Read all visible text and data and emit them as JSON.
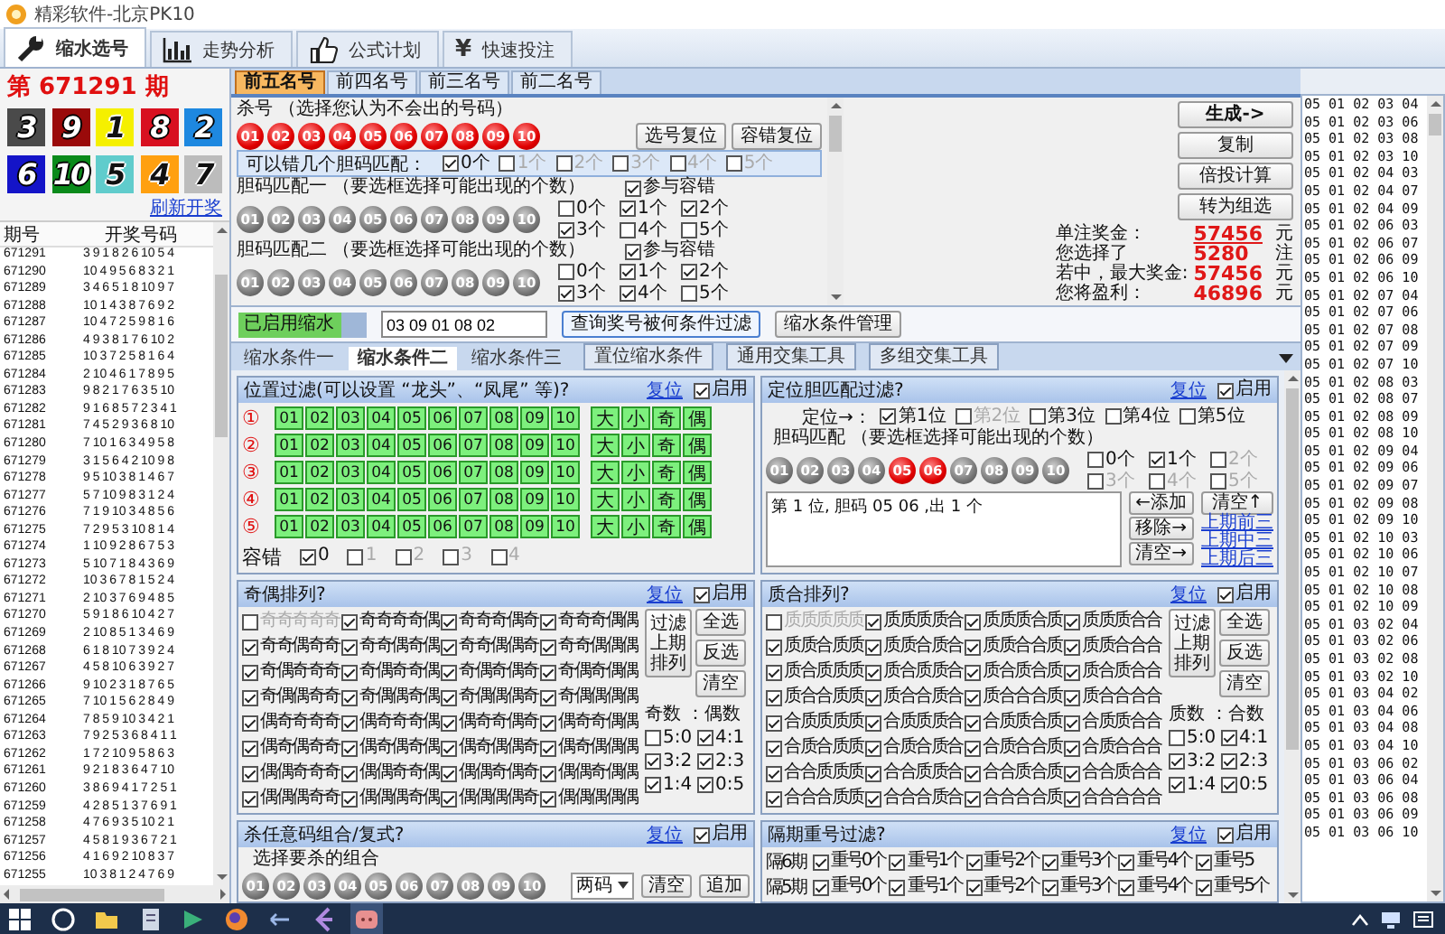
{
  "window": {
    "title": "精彩软件-北京PK10"
  },
  "main_tabs": [
    {
      "label": "缩水选号",
      "selected": true
    },
    {
      "label": "走势分析",
      "selected": false
    },
    {
      "label": "公式计划",
      "selected": false
    },
    {
      "label": "快速投注",
      "selected": false,
      "symbol": "¥"
    }
  ],
  "draw": {
    "title": "第 671291 期",
    "numbers": [
      {
        "label": "3",
        "color": "#4a4a4a"
      },
      {
        "label": "9",
        "color": "#9a0a0a"
      },
      {
        "label": "1",
        "color": "#f5f000"
      },
      {
        "label": "8",
        "color": "#d81020"
      },
      {
        "label": "2",
        "color": "#1e88e0"
      },
      {
        "label": "6",
        "color": "#1414c8"
      },
      {
        "label": "10",
        "color": "#0a8a1a"
      },
      {
        "label": "5",
        "color": "#60cccc"
      },
      {
        "label": "4",
        "color": "#ffa010"
      },
      {
        "label": "7",
        "color": "#bcbcbc"
      }
    ],
    "link": "刷新开奖"
  },
  "history": {
    "columns": [
      "期号",
      "开奖号码"
    ],
    "rows": [
      [
        "671291",
        "3 9 1 8 2 6 10 5 4"
      ],
      [
        "671290",
        "10 4 9 5 6 8 3 2 1"
      ],
      [
        "671289",
        "3 4 6 5 1 8 10 9 7"
      ],
      [
        "671288",
        "10 1 4 3 8 7 6 9 2"
      ],
      [
        "671287",
        "10 4 7 2 5 9 8 1 6"
      ],
      [
        "671286",
        "4 9 3 8 1 7 6 10 2"
      ],
      [
        "671285",
        "10 3 7 2 5 8 1 6 4"
      ],
      [
        "671284",
        "2 10 4 6 1 7 8 9 5"
      ],
      [
        "671283",
        "9 8 2 1 7 6 3 5 10"
      ],
      [
        "671282",
        "9 1 6 8 5 7 2 3 4 1"
      ],
      [
        "671281",
        "7 4 5 2 9 3 6 8 10"
      ],
      [
        "671280",
        "7 10 1 6 3 4 9 5 8"
      ],
      [
        "671279",
        "3 1 5 6 4 2 10 9 8"
      ],
      [
        "671278",
        "9 5 10 3 8 1 4 6 7"
      ],
      [
        "671277",
        "5 7 10 9 8 3 1 2 4"
      ],
      [
        "671276",
        "7 1 9 10 3 4 8 5 6"
      ],
      [
        "671275",
        "7 2 9 5 3 10 8 1 4"
      ],
      [
        "671274",
        "1 10 9 2 8 6 7 5 3"
      ],
      [
        "671273",
        "5 10 7 1 8 4 3 6 9"
      ],
      [
        "671272",
        "10 3 6 7 8 1 5 2 4"
      ],
      [
        "671271",
        "2 10 3 7 6 9 4 8 5"
      ],
      [
        "671270",
        "5 9 1 8 6 10 4 2 7"
      ],
      [
        "671269",
        "2 10 8 5 1 3 4 6 9"
      ],
      [
        "671268",
        "6 1 8 10 7 3 9 2 4"
      ],
      [
        "671267",
        "4 5 8 10 6 3 9 2 7"
      ],
      [
        "671266",
        "9 10 2 3 1 8 7 6 5"
      ],
      [
        "671265",
        "7 10 1 5 6 2 8 4 9"
      ],
      [
        "671264",
        "7 8 5 9 10 3 4 2 1"
      ],
      [
        "671263",
        "7 9 2 5 3 6 8 4 1 1"
      ],
      [
        "671262",
        "1 7 2 10 9 5 8 6 3"
      ],
      [
        "671261",
        "9 2 1 8 3 6 4 7 10"
      ],
      [
        "671260",
        "3 8 6 9 4 1 7 2 5 1"
      ],
      [
        "671259",
        "4 2 8 5 1 3 7 6 9 1"
      ],
      [
        "671258",
        "4 7 6 9 3 5 10 2 1"
      ],
      [
        "671257",
        "4 5 8 1 9 3 6 7 2 1"
      ],
      [
        "671256",
        "4 1 6 9 2 10 8 3 7"
      ],
      [
        "671255",
        "10 3 8 1 2 4 7 6 9"
      ]
    ]
  },
  "sub_tabs": [
    {
      "label": "前五名号",
      "selected": true
    },
    {
      "label": "前四名号",
      "selected": false
    },
    {
      "label": "前三名号",
      "selected": false
    },
    {
      "label": "前二名号",
      "selected": false
    }
  ],
  "kill": {
    "label": "杀号 （选择您认为不会出的号码）",
    "balls": [
      {
        "label": "01",
        "selected": true
      },
      {
        "label": "02",
        "selected": true
      },
      {
        "label": "03",
        "selected": true
      },
      {
        "label": "04",
        "selected": true
      },
      {
        "label": "05",
        "selected": true
      },
      {
        "label": "06",
        "selected": true
      },
      {
        "label": "07",
        "selected": true
      },
      {
        "label": "08",
        "selected": true
      },
      {
        "label": "09",
        "selected": true
      },
      {
        "label": "10",
        "selected": true
      }
    ],
    "buttons": [
      "选号复位",
      "容错复位"
    ]
  },
  "tolerance": {
    "label": "可以错几个胆码匹配：",
    "options": [
      {
        "label": "0个",
        "checked": true,
        "disabled": false
      },
      {
        "label": "1个",
        "checked": false,
        "disabled": true
      },
      {
        "label": "2个",
        "checked": false,
        "disabled": true
      },
      {
        "label": "3个",
        "checked": false,
        "disabled": true
      },
      {
        "label": "4个",
        "checked": false,
        "disabled": true
      },
      {
        "label": "5个",
        "checked": false,
        "disabled": true
      }
    ]
  },
  "matches": [
    {
      "label": "胆码匹配一 （要选框选择可能出现的个数）",
      "participate": {
        "label": "参与容错",
        "checked": true
      },
      "balls": [
        {
          "label": "01",
          "selected": false
        },
        {
          "label": "02",
          "selected": false
        },
        {
          "label": "03",
          "selected": false
        },
        {
          "label": "04",
          "selected": false
        },
        {
          "label": "05",
          "selected": false
        },
        {
          "label": "06",
          "selected": false
        },
        {
          "label": "07",
          "selected": false
        },
        {
          "label": "08",
          "selected": false
        },
        {
          "label": "09",
          "selected": false
        },
        {
          "label": "10",
          "selected": false
        }
      ],
      "counts": [
        {
          "label": "0个",
          "checked": false,
          "disabled": false
        },
        {
          "label": "1个",
          "checked": true,
          "disabled": false
        },
        {
          "label": "2个",
          "checked": true,
          "disabled": false
        },
        {
          "label": "3个",
          "checked": true,
          "disabled": false
        },
        {
          "label": "4个",
          "checked": false,
          "disabled": false
        },
        {
          "label": "5个",
          "checked": false,
          "disabled": false
        }
      ]
    },
    {
      "label": "胆码匹配二 （要选框选择可能出现的个数）",
      "participate": {
        "label": "参与容错",
        "checked": true
      },
      "balls": [
        {
          "label": "01",
          "selected": false
        },
        {
          "label": "02",
          "selected": false
        },
        {
          "label": "03",
          "selected": false
        },
        {
          "label": "04",
          "selected": false
        },
        {
          "label": "05",
          "selected": false
        },
        {
          "label": "06",
          "selected": false
        },
        {
          "label": "07",
          "selected": false
        },
        {
          "label": "08",
          "selected": false
        },
        {
          "label": "09",
          "selected": false
        },
        {
          "label": "10",
          "selected": false
        }
      ],
      "counts": [
        {
          "label": "0个",
          "checked": false,
          "disabled": false
        },
        {
          "label": "1个",
          "checked": true,
          "disabled": false
        },
        {
          "label": "2个",
          "checked": true,
          "disabled": false
        },
        {
          "label": "3个",
          "checked": true,
          "disabled": false
        },
        {
          "label": "4个",
          "checked": true,
          "disabled": false
        },
        {
          "label": "5个",
          "checked": false,
          "disabled": false
        }
      ]
    }
  ],
  "actions": [
    "生成->",
    "复制",
    "倍投计算",
    "转为组选"
  ],
  "stats": [
    {
      "label": "单注奖金：",
      "value": "57456",
      "unit": "元",
      "kind": "link"
    },
    {
      "label": "您选择了",
      "value": "5280",
      "unit": "注",
      "kind": "plain"
    },
    {
      "label": "若中，最大奖金:",
      "value": "57456",
      "unit": "元",
      "kind": "plain"
    },
    {
      "label": "您将盈利：",
      "value": "46896",
      "unit": "元",
      "kind": "plain"
    }
  ],
  "filter_bar": {
    "status": "已启用缩水",
    "value": "03 09 01 08 02",
    "buttons": [
      "查询奖号被何条件过滤",
      "缩水条件管理"
    ]
  },
  "condition_tabs": [
    {
      "label": "缩水条件一",
      "selected": false,
      "kind": "tab"
    },
    {
      "label": "缩水条件二",
      "selected": true,
      "kind": "tab"
    },
    {
      "label": "缩水条件三",
      "selected": false,
      "kind": "tab"
    },
    {
      "label": "置位缩水条件",
      "selected": false,
      "kind": "button"
    },
    {
      "label": "通用交集工具",
      "selected": false,
      "kind": "button"
    },
    {
      "label": "多组交集工具",
      "selected": false,
      "kind": "button"
    }
  ],
  "position_filter": {
    "title": "位置过滤(可以设置 “龙头”、“凤尾” 等)?",
    "reset": "复位",
    "enable": {
      "label": "启用",
      "checked": true
    },
    "rows": [
      {
        "mark": "①",
        "numbers": [
          "01",
          "02",
          "03",
          "04",
          "05",
          "06",
          "07",
          "08",
          "09",
          "10"
        ],
        "attributes": [
          "大",
          "小",
          "奇",
          "偶"
        ]
      },
      {
        "mark": "②",
        "numbers": [
          "01",
          "02",
          "03",
          "04",
          "05",
          "06",
          "07",
          "08",
          "09",
          "10"
        ],
        "attributes": [
          "大",
          "小",
          "奇",
          "偶"
        ]
      },
      {
        "mark": "③",
        "numbers": [
          "01",
          "02",
          "03",
          "04",
          "05",
          "06",
          "07",
          "08",
          "09",
          "10"
        ],
        "attributes": [
          "大",
          "小",
          "奇",
          "偶"
        ]
      },
      {
        "mark": "④",
        "numbers": [
          "01",
          "02",
          "03",
          "04",
          "05",
          "06",
          "07",
          "08",
          "09",
          "10"
        ],
        "attributes": [
          "大",
          "小",
          "奇",
          "偶"
        ]
      },
      {
        "mark": "⑤",
        "numbers": [
          "01",
          "02",
          "03",
          "04",
          "05",
          "06",
          "07",
          "08",
          "09",
          "10"
        ],
        "attributes": [
          "大",
          "小",
          "奇",
          "偶"
        ]
      }
    ],
    "tolerance_label": "容错",
    "tolerance": [
      {
        "label": "0",
        "checked": true,
        "disabled": false
      },
      {
        "label": "1",
        "checked": false,
        "disabled": true
      },
      {
        "label": "2",
        "checked": false,
        "disabled": true
      },
      {
        "label": "3",
        "checked": false,
        "disabled": true
      },
      {
        "label": "4",
        "checked": false,
        "disabled": true
      }
    ]
  },
  "position_match": {
    "title": "定位胆匹配过滤?",
    "reset": "复位",
    "enable": {
      "label": "启用",
      "checked": true
    },
    "position_label": "定位→：",
    "positions": [
      {
        "label": "第1位",
        "checked": true,
        "disabled": false
      },
      {
        "label": "第2位",
        "checked": false,
        "disabled": true
      },
      {
        "label": "第3位",
        "checked": false,
        "disabled": false
      },
      {
        "label": "第4位",
        "checked": false,
        "disabled": false
      },
      {
        "label": "第5位",
        "checked": false,
        "disabled": false
      }
    ],
    "match_label": "胆码匹配 （要选框选择可能出现的个数）",
    "balls": [
      {
        "label": "01",
        "selected": false
      },
      {
        "label": "02",
        "selected": false
      },
      {
        "label": "03",
        "selected": false
      },
      {
        "label": "04",
        "selected": false
      },
      {
        "label": "05",
        "selected": true
      },
      {
        "label": "06",
        "selected": true
      },
      {
        "label": "07",
        "selected": false
      },
      {
        "label": "08",
        "selected": false
      },
      {
        "label": "09",
        "selected": false
      },
      {
        "label": "10",
        "selected": false
      }
    ],
    "counts": [
      {
        "label": "0个",
        "checked": false,
        "disabled": false
      },
      {
        "label": "1个",
        "checked": true,
        "disabled": false
      },
      {
        "label": "2个",
        "checked": false,
        "disabled": true
      },
      {
        "label": "3个",
        "checked": false,
        "disabled": true
      },
      {
        "label": "4个",
        "checked": false,
        "disabled": true
      },
      {
        "label": "5个",
        "checked": false,
        "disabled": true
      }
    ],
    "result": "第 1 位, 胆码 05 06 ,出 1 个",
    "buttons": [
      "←添加",
      "移除→",
      "清空→"
    ],
    "clear": "清空↑",
    "links": [
      "上期前三",
      "上期中三",
      "上期后三"
    ]
  },
  "odd_even": {
    "title": "奇偶排列?",
    "reset": "复位",
    "enable": {
      "label": "启用",
      "checked": true
    },
    "patterns": [
      {
        "label": "奇奇奇奇奇",
        "checked": false,
        "disabled": true
      },
      {
        "label": "奇奇奇奇偶",
        "checked": true,
        "disabled": false
      },
      {
        "label": "奇奇奇偶奇",
        "checked": true,
        "disabled": false
      },
      {
        "label": "奇奇奇偶偶",
        "checked": true,
        "disabled": false
      },
      {
        "label": "奇奇偶奇奇",
        "checked": true,
        "disabled": false
      },
      {
        "label": "奇奇偶奇偶",
        "checked": true,
        "disabled": false
      },
      {
        "label": "奇奇偶偶奇",
        "checked": true,
        "disabled": false
      },
      {
        "label": "奇奇偶偶偶",
        "checked": true,
        "disabled": false
      },
      {
        "label": "奇偶奇奇奇",
        "checked": true,
        "disabled": false
      },
      {
        "label": "奇偶奇奇偶",
        "checked": true,
        "disabled": false
      },
      {
        "label": "奇偶奇偶奇",
        "checked": true,
        "disabled": false
      },
      {
        "label": "奇偶奇偶偶",
        "checked": true,
        "disabled": false
      },
      {
        "label": "奇偶偶奇奇",
        "checked": true,
        "disabled": false
      },
      {
        "label": "奇偶偶奇偶",
        "checked": true,
        "disabled": false
      },
      {
        "label": "奇偶偶偶奇",
        "checked": true,
        "disabled": false
      },
      {
        "label": "奇偶偶偶偶",
        "checked": true,
        "disabled": false
      },
      {
        "label": "偶奇奇奇奇",
        "checked": true,
        "disabled": false
      },
      {
        "label": "偶奇奇奇偶",
        "checked": true,
        "disabled": false
      },
      {
        "label": "偶奇奇偶奇",
        "checked": true,
        "disabled": false
      },
      {
        "label": "偶奇奇偶偶",
        "checked": true,
        "disabled": false
      },
      {
        "label": "偶奇偶奇奇",
        "checked": true,
        "disabled": false
      },
      {
        "label": "偶奇偶奇偶",
        "checked": true,
        "disabled": false
      },
      {
        "label": "偶奇偶偶奇",
        "checked": true,
        "disabled": false
      },
      {
        "label": "偶奇偶偶偶",
        "checked": true,
        "disabled": false
      },
      {
        "label": "偶偶奇奇奇",
        "checked": true,
        "disabled": false
      },
      {
        "label": "偶偶奇奇偶",
        "checked": true,
        "disabled": false
      },
      {
        "label": "偶偶奇偶奇",
        "checked": true,
        "disabled": false
      },
      {
        "label": "偶偶奇偶偶",
        "checked": true,
        "disabled": false
      },
      {
        "label": "偶偶偶奇奇",
        "checked": true,
        "disabled": false
      },
      {
        "label": "偶偶偶奇偶",
        "checked": true,
        "disabled": false
      },
      {
        "label": "偶偶偶偶奇",
        "checked": true,
        "disabled": false
      },
      {
        "label": "偶偶偶偶偶",
        "checked": true,
        "disabled": false
      }
    ],
    "filter_button": "过滤上期排列",
    "buttons": [
      "全选",
      "反选",
      "清空"
    ],
    "ratio_label": "奇数 ：偶数",
    "ratios": [
      {
        "label": "5:0",
        "checked": false,
        "disabled": false
      },
      {
        "label": "4:1",
        "checked": true,
        "disabled": false
      },
      {
        "label": "3:2",
        "checked": true,
        "disabled": false
      },
      {
        "label": "2:3",
        "checked": true,
        "disabled": false
      },
      {
        "label": "1:4",
        "checked": true,
        "disabled": false
      },
      {
        "label": "0:5",
        "checked": true,
        "disabled": false
      }
    ]
  },
  "prime_composite": {
    "title": "质合排列?",
    "reset": "复位",
    "enable": {
      "label": "启用",
      "checked": true
    },
    "patterns": [
      {
        "label": "质质质质质",
        "checked": false,
        "disabled": true
      },
      {
        "label": "质质质质合",
        "checked": true,
        "disabled": false
      },
      {
        "label": "质质质合质",
        "checked": true,
        "disabled": false
      },
      {
        "label": "质质质合合",
        "checked": true,
        "disabled": false
      },
      {
        "label": "质质合质质",
        "checked": true,
        "disabled": false
      },
      {
        "label": "质质合质合",
        "checked": true,
        "disabled": false
      },
      {
        "label": "质质合合质",
        "checked": true,
        "disabled": false
      },
      {
        "label": "质质合合合",
        "checked": true,
        "disabled": false
      },
      {
        "label": "质合质质质",
        "checked": true,
        "disabled": false
      },
      {
        "label": "质合质质合",
        "checked": true,
        "disabled": false
      },
      {
        "label": "质合质合质",
        "checked": true,
        "disabled": false
      },
      {
        "label": "质合质合合",
        "checked": true,
        "disabled": false
      },
      {
        "label": "质合合质质",
        "checked": true,
        "disabled": false
      },
      {
        "label": "质合合质合",
        "checked": true,
        "disabled": false
      },
      {
        "label": "质合合合质",
        "checked": true,
        "disabled": false
      },
      {
        "label": "质合合合合",
        "checked": true,
        "disabled": false
      },
      {
        "label": "合质质质质",
        "checked": true,
        "disabled": false
      },
      {
        "label": "合质质质合",
        "checked": true,
        "disabled": false
      },
      {
        "label": "合质质合质",
        "checked": true,
        "disabled": false
      },
      {
        "label": "合质质合合",
        "checked": true,
        "disabled": false
      },
      {
        "label": "合质合质质",
        "checked": true,
        "disabled": false
      },
      {
        "label": "合质合质合",
        "checked": true,
        "disabled": false
      },
      {
        "label": "合质合合质",
        "checked": true,
        "disabled": false
      },
      {
        "label": "合质合合合",
        "checked": true,
        "disabled": false
      },
      {
        "label": "合合质质质",
        "checked": true,
        "disabled": false
      },
      {
        "label": "合合质质合",
        "checked": true,
        "disabled": false
      },
      {
        "label": "合合质合质",
        "checked": true,
        "disabled": false
      },
      {
        "label": "合合质合合",
        "checked": true,
        "disabled": false
      },
      {
        "label": "合合合质质",
        "checked": true,
        "disabled": false
      },
      {
        "label": "合合合质合",
        "checked": true,
        "disabled": false
      },
      {
        "label": "合合合合质",
        "checked": true,
        "disabled": false
      },
      {
        "label": "合合合合合",
        "checked": true,
        "disabled": false
      }
    ],
    "filter_button": "过滤上期排列",
    "buttons": [
      "全选",
      "反选",
      "清空"
    ],
    "ratio_label": "质数 ：合数",
    "ratios": [
      {
        "label": "5:0",
        "checked": false,
        "disabled": false
      },
      {
        "label": "4:1",
        "checked": true,
        "disabled": false
      },
      {
        "label": "3:2",
        "checked": true,
        "disabled": false
      },
      {
        "label": "2:3",
        "checked": true,
        "disabled": false
      },
      {
        "label": "1:4",
        "checked": true,
        "disabled": false
      },
      {
        "label": "0:5",
        "checked": true,
        "disabled": false
      }
    ]
  },
  "kill_combo": {
    "title": "杀任意码组合/复式?",
    "reset": "复位",
    "enable": {
      "label": "启用",
      "checked": true
    },
    "label": "选择要杀的组合",
    "balls": [
      {
        "label": "01",
        "selected": false
      },
      {
        "label": "02",
        "selected": false
      },
      {
        "label": "03",
        "selected": false
      },
      {
        "label": "04",
        "selected": false
      },
      {
        "label": "05",
        "selected": false
      },
      {
        "label": "06",
        "selected": false
      },
      {
        "label": "07",
        "selected": false
      },
      {
        "label": "08",
        "selected": false
      },
      {
        "label": "09",
        "selected": false
      },
      {
        "label": "10",
        "selected": false
      }
    ],
    "dropdown": "两码",
    "buttons": [
      "清空",
      "追加"
    ]
  },
  "repeat_filter": {
    "title": "隔期重号过滤?",
    "reset": "复位",
    "enable": {
      "label": "启用",
      "checked": true
    },
    "rows": [
      {
        "label": "隔6期",
        "options": [
          {
            "label": "重号0个",
            "checked": true,
            "disabled": false
          },
          {
            "label": "重号1个",
            "checked": true,
            "disabled": false
          },
          {
            "label": "重号2个",
            "checked": true,
            "disabled": false
          },
          {
            "label": "重号3个",
            "checked": true,
            "disabled": false
          },
          {
            "label": "重号4个",
            "checked": true,
            "disabled": false
          },
          {
            "label": "重号5",
            "checked": true,
            "disabled": false
          }
        ]
      },
      {
        "label": "隔5期",
        "options": [
          {
            "label": "重号0个",
            "checked": true,
            "disabled": false
          },
          {
            "label": "重号1个",
            "checked": true,
            "disabled": false
          },
          {
            "label": "重号2个",
            "checked": true,
            "disabled": false
          },
          {
            "label": "重号3个",
            "checked": true,
            "disabled": false
          },
          {
            "label": "重号4个",
            "checked": true,
            "disabled": false
          },
          {
            "label": "重号5个",
            "checked": true,
            "disabled": false
          }
        ]
      }
    ]
  },
  "result_list": [
    "05 01 02 03 04",
    "05 01 02 03 06",
    "05 01 02 03 08",
    "05 01 02 03 10",
    "05 01 02 04 03",
    "05 01 02 04 07",
    "05 01 02 04 09",
    "05 01 02 06 03",
    "05 01 02 06 07",
    "05 01 02 06 09",
    "05 01 02 06 10",
    "05 01 02 07 04",
    "05 01 02 07 06",
    "05 01 02 07 08",
    "05 01 02 07 09",
    "05 01 02 07 10",
    "05 01 02 08 03",
    "05 01 02 08 07",
    "05 01 02 08 09",
    "05 01 02 08 10",
    "05 01 02 09 04",
    "05 01 02 09 06",
    "05 01 02 09 07",
    "05 01 02 09 08",
    "05 01 02 09 10",
    "05 01 02 10 03",
    "05 01 02 10 06",
    "05 01 02 10 07",
    "05 01 02 10 08",
    "05 01 02 10 09",
    "05 01 03 02 04",
    "05 01 03 02 06",
    "05 01 03 02 08",
    "05 01 03 02 10",
    "05 01 03 04 02",
    "05 01 03 04 06",
    "05 01 03 04 08",
    "05 01 03 04 10",
    "05 01 03 06 02",
    "05 01 03 06 04",
    "05 01 03 06 08",
    "05 01 03 06 09",
    "05 01 03 06 10"
  ]
}
